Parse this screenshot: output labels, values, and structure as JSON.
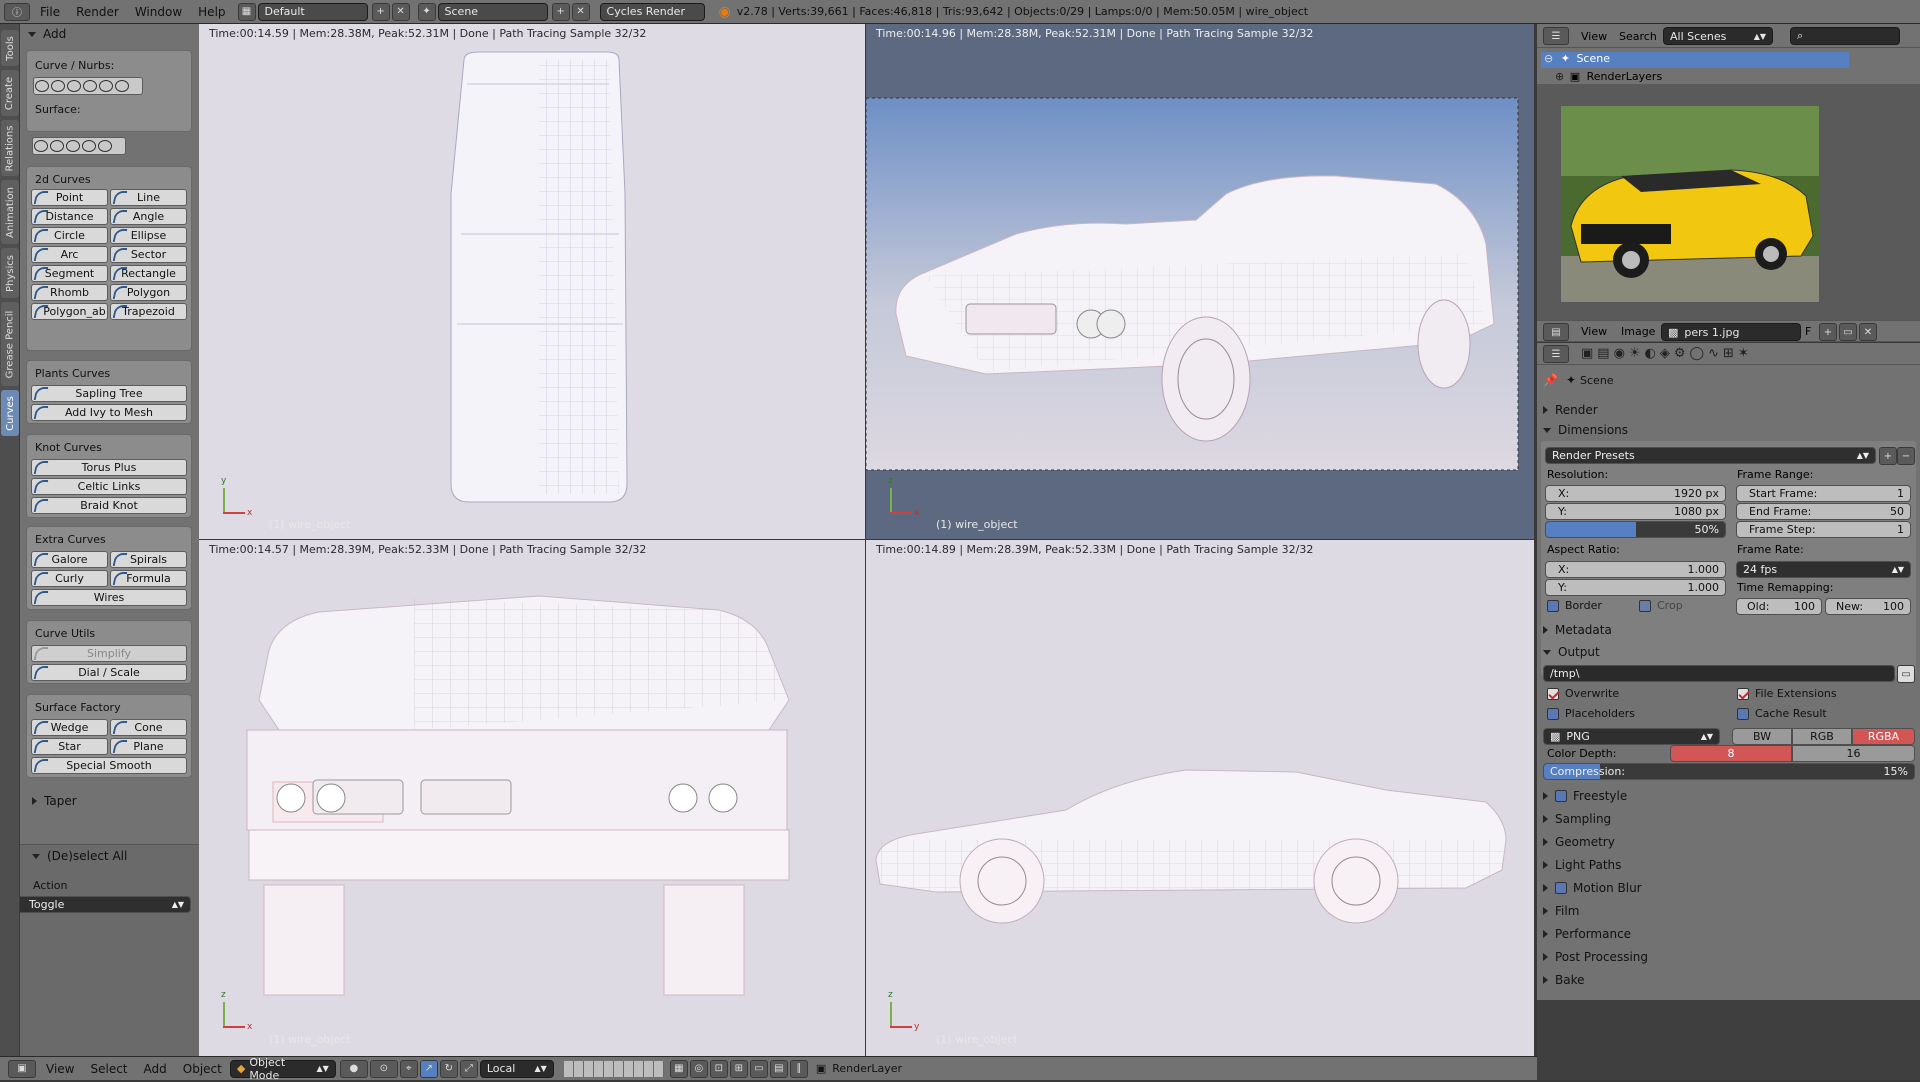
{
  "topbar": {
    "menus": [
      "File",
      "Render",
      "Window",
      "Help"
    ],
    "layout": "Default",
    "scene": "Scene",
    "engine": "Cycles Render",
    "stats": "v2.78 | Verts:39,661 | Faces:46,818 | Tris:93,642 | Objects:0/29 | Lamps:0/0 | Mem:50.05M | wire_object"
  },
  "left_tabs": [
    "Tools",
    "Create",
    "Relations",
    "Animation",
    "Physics",
    "Grease Pencil",
    "Curves"
  ],
  "toolshelf": {
    "add_header": "Add",
    "curve_nurbs_label": "Curve / Nurbs:",
    "surface_label": "Surface:",
    "curves2d": {
      "title": "2d Curves",
      "buttons": [
        "Point",
        "Line",
        "Distance",
        "Angle",
        "Circle",
        "Ellipse",
        "Arc",
        "Sector",
        "Segment",
        "Rectangle",
        "Rhomb",
        "Polygon",
        "Polygon_ab",
        "Trapezoid"
      ]
    },
    "plants": {
      "title": "Plants Curves",
      "buttons": [
        "Sapling Tree",
        "Add Ivy to Mesh"
      ]
    },
    "knots": {
      "title": "Knot Curves",
      "buttons": [
        "Torus Plus",
        "Celtic Links",
        "Braid Knot"
      ]
    },
    "extra": {
      "title": "Extra Curves",
      "buttons": [
        "Galore",
        "Spirals",
        "Curly",
        "Formula",
        "Wires"
      ]
    },
    "utils": {
      "title": "Curve Utils",
      "buttons": [
        "Simplify",
        "Dial / Scale"
      ]
    },
    "surface_factory": {
      "title": "Surface Factory",
      "buttons": [
        "Wedge",
        "Cone",
        "Star",
        "Plane",
        "Special Smooth"
      ]
    },
    "taper": "Taper",
    "deselect_header": "(De)select All",
    "action_label": "Action",
    "action_value": "Toggle"
  },
  "viewports": [
    {
      "header": "Time:00:14.59 | Mem:28.38M, Peak:52.31M | Done | Path Tracing Sample 32/32",
      "object": "(1) wire_object",
      "axis_v": "y",
      "axis_h": "x"
    },
    {
      "header": "Time:00:14.96 | Mem:28.38M, Peak:52.31M | Done | Path Tracing Sample 32/32",
      "object": "(1) wire_object",
      "axis_v": "z",
      "axis_h": "x"
    },
    {
      "header": "Time:00:14.57 | Mem:28.39M, Peak:52.33M | Done | Path Tracing Sample 32/32",
      "object": "(1) wire_object",
      "axis_v": "z",
      "axis_h": "x"
    },
    {
      "header": "Time:00:14.89 | Mem:28.39M, Peak:52.33M | Done | Path Tracing Sample 32/32",
      "object": "(1) wire_object",
      "axis_v": "z",
      "axis_h": "y"
    }
  ],
  "outliner": {
    "menus": [
      "View",
      "Search"
    ],
    "scene_filter": "All Scenes",
    "items": [
      "Scene",
      "RenderLayers"
    ]
  },
  "image_editor": {
    "menus": [
      "View",
      "Image"
    ],
    "image_name": "pers 1.jpg",
    "f_label": "F"
  },
  "properties": {
    "context": "Scene",
    "sections": {
      "render": "Render",
      "dimensions": "Dimensions",
      "render_presets": "Render Presets",
      "resolution_label": "Resolution:",
      "res_x_label": "X:",
      "res_x": "1920 px",
      "res_y_label": "Y:",
      "res_y": "1080 px",
      "res_pct": "50%",
      "res_pct_value": 0.5,
      "frame_range_label": "Frame Range:",
      "start_label": "Start Frame:",
      "start": "1",
      "end_label": "End Frame:",
      "end": "50",
      "step_label": "Frame Step:",
      "step": "1",
      "aspect_label": "Aspect Ratio:",
      "asp_x_label": "X:",
      "asp_x": "1.000",
      "asp_y_label": "Y:",
      "asp_y": "1.000",
      "frame_rate_label": "Frame Rate:",
      "frame_rate": "24 fps",
      "time_remap_label": "Time Remapping:",
      "old_label": "Old:",
      "old": "100",
      "new_label": "New:",
      "new": "100",
      "border": "Border",
      "crop": "Crop",
      "metadata": "Metadata",
      "output": "Output",
      "path": "/tmp\\",
      "overwrite": "Overwrite",
      "file_extensions": "File Extensions",
      "placeholders": "Placeholders",
      "cache_result": "Cache Result",
      "format": "PNG",
      "bw": "BW",
      "rgb": "RGB",
      "rgba": "RGBA",
      "color_depth_label": "Color Depth:",
      "depth8": "8",
      "depth16": "16",
      "compression_label": "Compression:",
      "compression": "15%",
      "compression_value": 0.15,
      "freestyle": "Freestyle",
      "sampling": "Sampling",
      "geometry": "Geometry",
      "light_paths": "Light Paths",
      "motion_blur": "Motion Blur",
      "film": "Film",
      "performance": "Performance",
      "post_processing": "Post Processing",
      "bake": "Bake"
    }
  },
  "bottombar": {
    "menus": [
      "View",
      "Select",
      "Add",
      "Object"
    ],
    "mode": "Object Mode",
    "orientation": "Local",
    "render_layer": "RenderLayer"
  },
  "colors": {
    "ui_bg": "#727272",
    "accent_blue": "#5878b6",
    "rgba_red": "#d35656",
    "viewport_bg": "#dedae3",
    "sky_top": "#6f8fc0"
  }
}
